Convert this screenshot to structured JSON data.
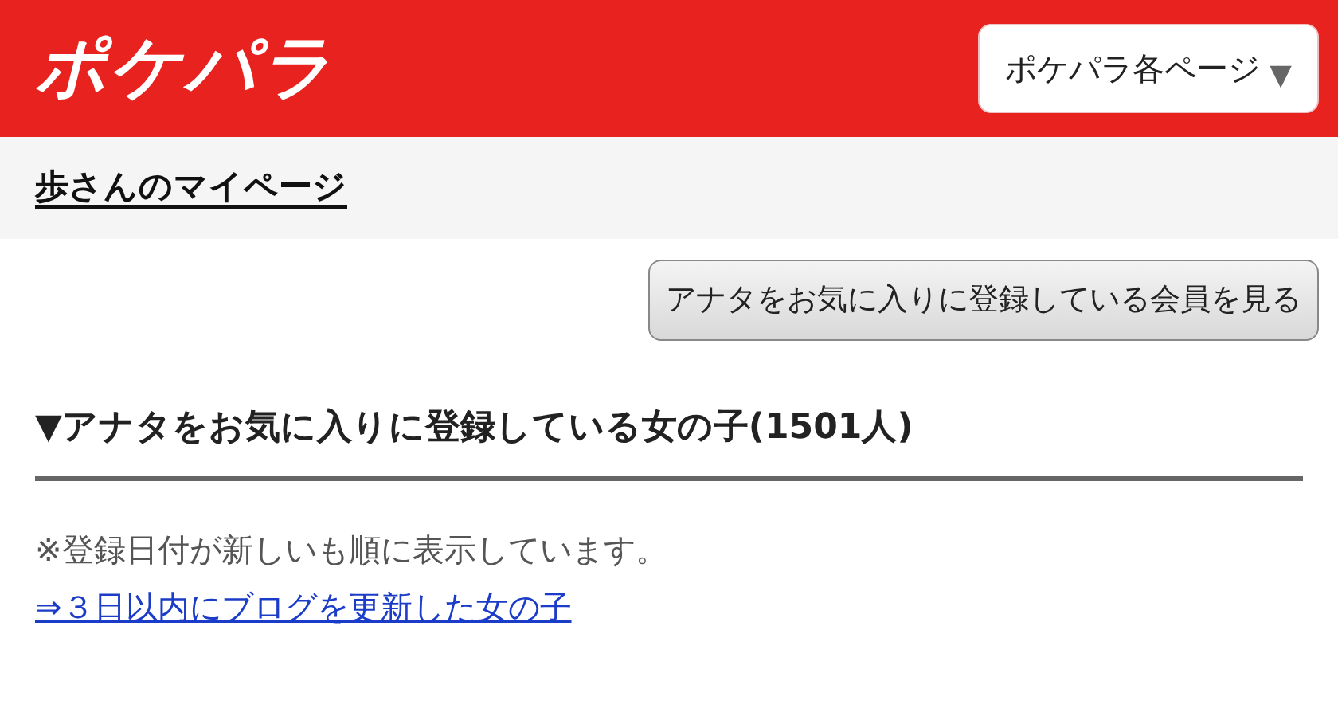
{
  "header": {
    "logo": "ポケパラ",
    "menu_button": {
      "label": "ポケパラ各ページ",
      "caret": "▼"
    }
  },
  "breadcrumb": {
    "link": "歩さんのマイページ"
  },
  "action_button": {
    "label": "アナタをお気に入りに登録している会員を見る"
  },
  "section": {
    "heading": "▼アナタをお気に入りに登録している女の子(1501人)",
    "note": "※登録日付が新しいも順に表示しています。",
    "link": "⇒３日以内にブログを更新した女の子"
  }
}
